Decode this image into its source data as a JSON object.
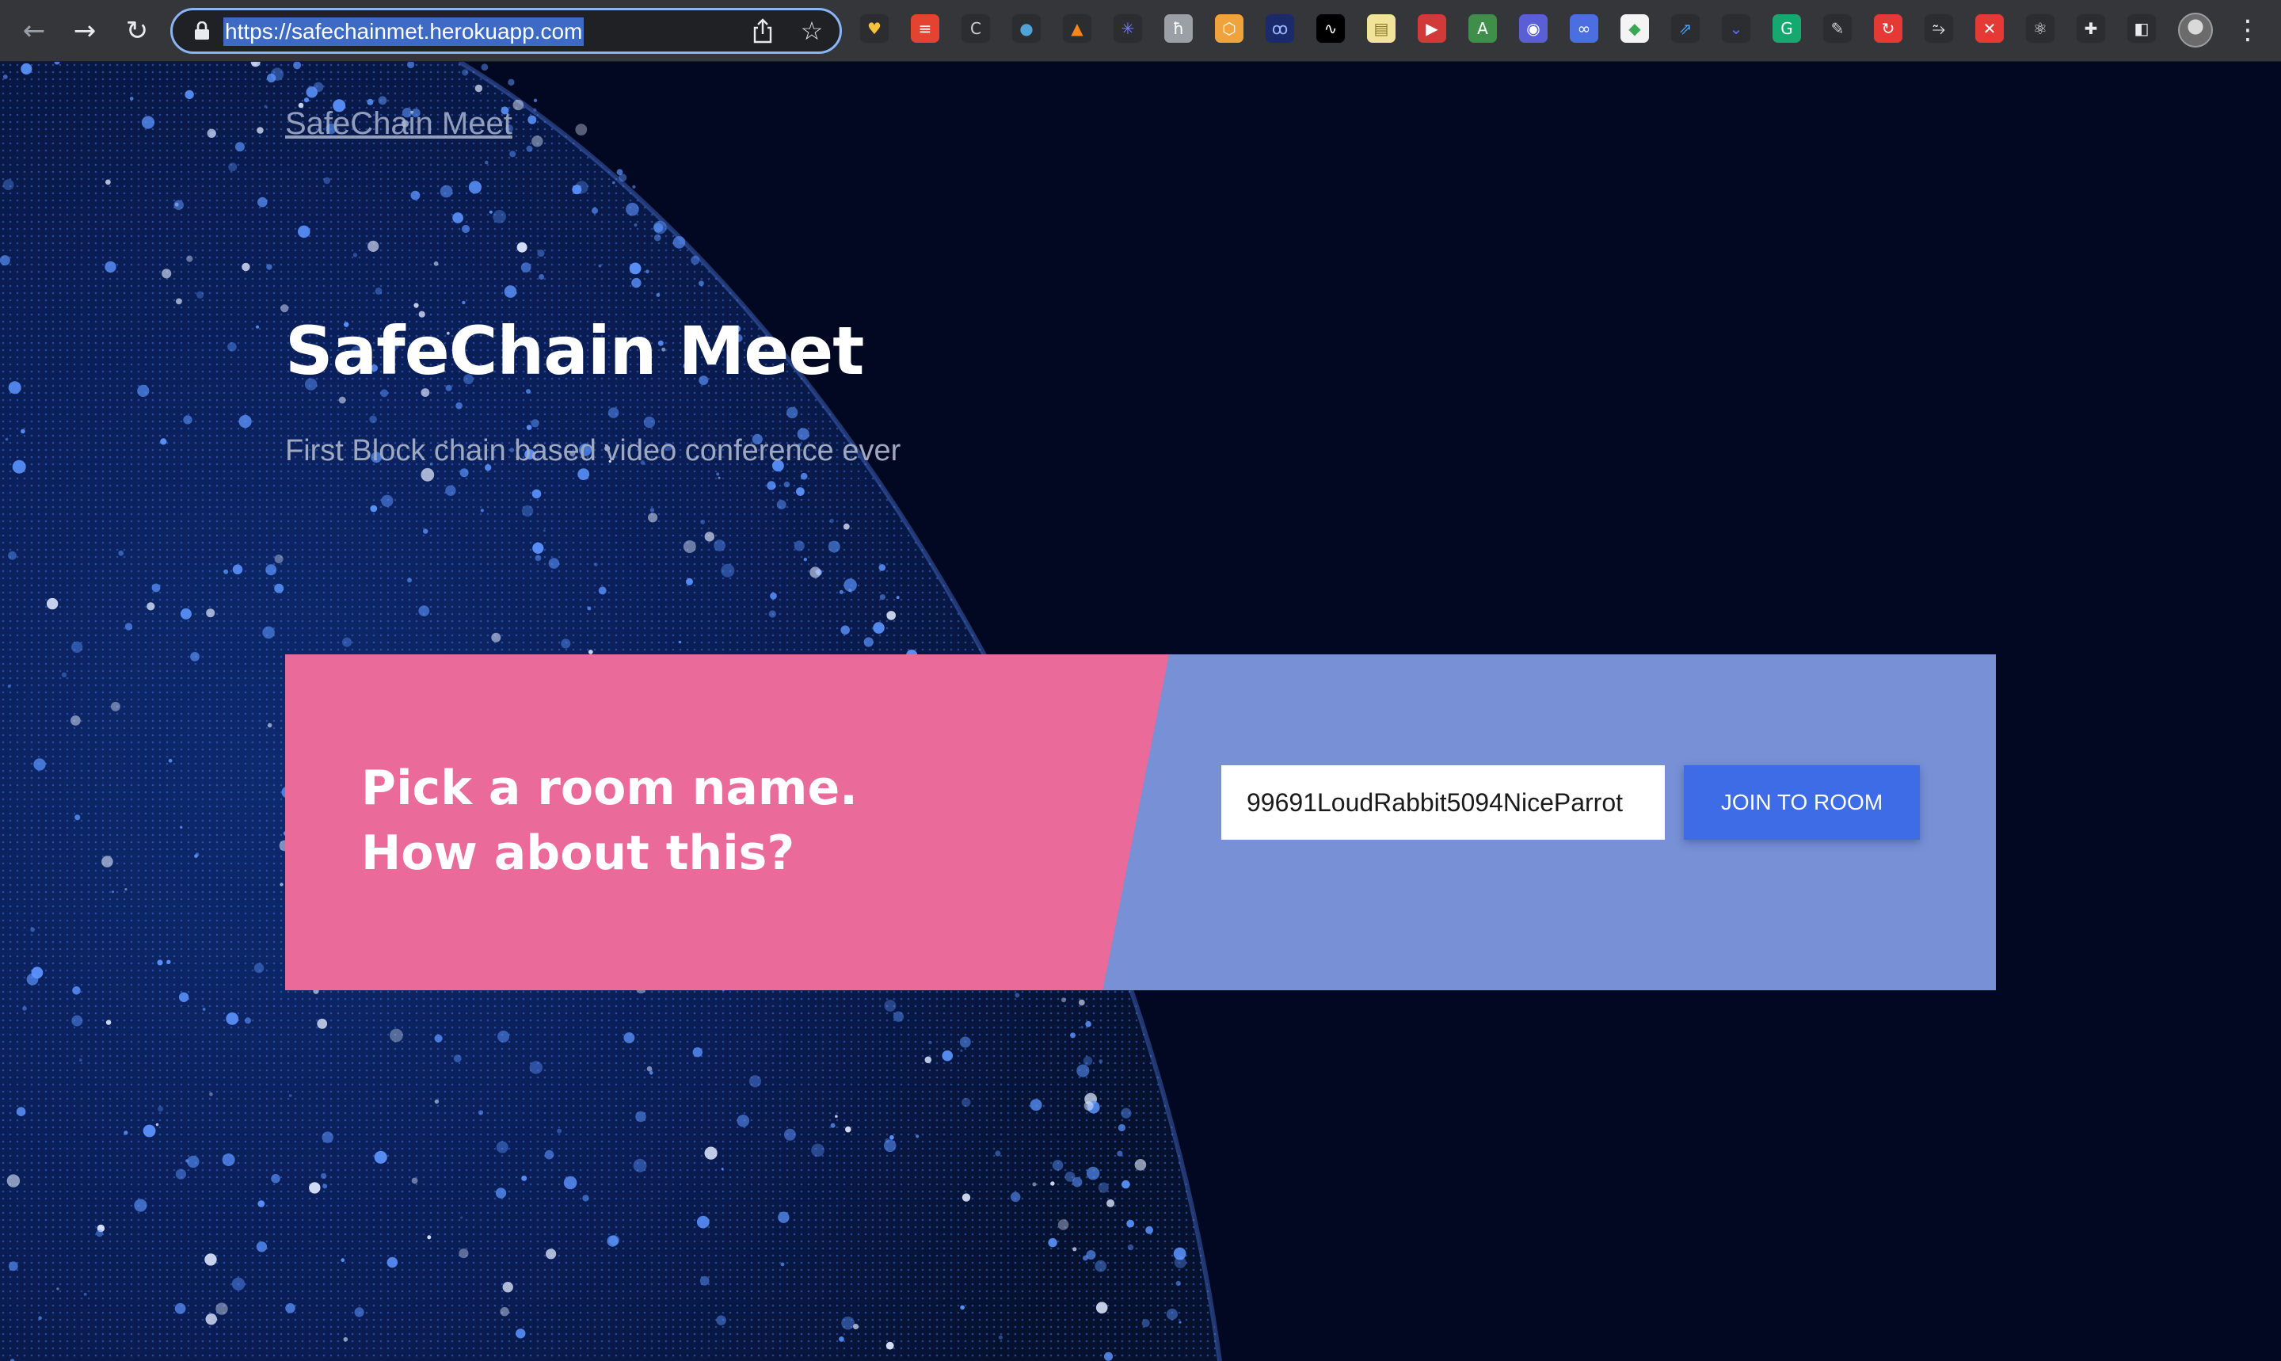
{
  "browser": {
    "url": "https://safechainmet.herokuapp.com",
    "extensions": [
      {
        "name": "heart-extension-icon",
        "glyph": "♥",
        "bg": "#2c2d31",
        "fg": "#f9c23c"
      },
      {
        "name": "todoist-extension-icon",
        "glyph": "≡",
        "bg": "#e44332",
        "fg": "#ffffff"
      },
      {
        "name": "c-extension-icon",
        "glyph": "C",
        "bg": "#2c2d31",
        "fg": "#cfd2d6"
      },
      {
        "name": "globe-extension-icon",
        "glyph": "●",
        "bg": "#2c2d31",
        "fg": "#4fa3d9"
      },
      {
        "name": "metamask-fox-icon",
        "glyph": "▲",
        "bg": "#2c2d31",
        "fg": "#f6851b"
      },
      {
        "name": "snowflake-extension-icon",
        "glyph": "✳",
        "bg": "#2c2d31",
        "fg": "#6f7cff"
      },
      {
        "name": "h-extension-icon",
        "glyph": "ħ",
        "bg": "#9aa0a6",
        "fg": "#ffffff"
      },
      {
        "name": "hexagon-extension-icon",
        "glyph": "⬡",
        "bg": "#f0a33c",
        "fg": "#ffffff"
      },
      {
        "name": "oo-extension-icon",
        "glyph": "ꝏ",
        "bg": "#1b2a6b",
        "fg": "#9fb6ff"
      },
      {
        "name": "wave-extension-icon",
        "glyph": "∿",
        "bg": "#000000",
        "fg": "#ffffff"
      },
      {
        "name": "notes-extension-icon",
        "glyph": "▤",
        "bg": "#f2e39a",
        "fg": "#8a7a2a"
      },
      {
        "name": "play-extension-icon",
        "glyph": "▶",
        "bg": "#d23a3a",
        "fg": "#ffffff"
      },
      {
        "name": "translate-extension-icon",
        "glyph": "A",
        "bg": "#3f8f4a",
        "fg": "#ffffff"
      },
      {
        "name": "eye-extension-icon",
        "glyph": "◉",
        "bg": "#5a5fd6",
        "fg": "#ffffff"
      },
      {
        "name": "infinity-extension-icon",
        "glyph": "∞",
        "bg": "#4b6fe0",
        "fg": "#ffffff"
      },
      {
        "name": "diamond-extension-icon",
        "glyph": "◆",
        "bg": "#f4f4f4",
        "fg": "#3aa657"
      },
      {
        "name": "chart-extension-icon",
        "glyph": "⇗",
        "bg": "#2c2d31",
        "fg": "#4aa3ff"
      },
      {
        "name": "chevrons-extension-icon",
        "glyph": "⌄",
        "bg": "#2c2d31",
        "fg": "#5b6cff"
      },
      {
        "name": "grammarly-extension-icon",
        "glyph": "G",
        "bg": "#15a86f",
        "fg": "#ffffff"
      },
      {
        "name": "pen-extension-icon",
        "glyph": "✎",
        "bg": "#2c2d31",
        "fg": "#cfd2d6"
      },
      {
        "name": "sync-extension-icon",
        "glyph": "↻",
        "bg": "#e53935",
        "fg": "#ffffff"
      },
      {
        "name": "link-extension-icon",
        "glyph": "⥲",
        "bg": "#2c2d31",
        "fg": "#e8eaed"
      },
      {
        "name": "close-extension-icon",
        "glyph": "✕",
        "bg": "#e53935",
        "fg": "#ffffff"
      },
      {
        "name": "react-extension-icon",
        "glyph": "⚛",
        "bg": "#2c2d31",
        "fg": "#e8eaed"
      },
      {
        "name": "puzzle-extensions-icon",
        "glyph": "✚",
        "bg": "#2c2d31",
        "fg": "#e8eaed"
      },
      {
        "name": "side-panel-icon",
        "glyph": "◧",
        "bg": "#2c2d31",
        "fg": "#e8eaed"
      }
    ]
  },
  "header": {
    "brand_link": "SafeChain Meet"
  },
  "hero": {
    "title": "SafeChain Meet",
    "subtitle": "First Block chain based video conference ever"
  },
  "room_card": {
    "prompt_line1": "Pick a room name.",
    "prompt_line2": "How about this?",
    "room_name_value": "99691LoudRabbit5094NiceParrot",
    "join_button_label": "JOIN TO ROOM",
    "colors": {
      "pink": "#ea6a99",
      "periwinkle": "#7890d6",
      "button": "#3d6ce6"
    }
  }
}
